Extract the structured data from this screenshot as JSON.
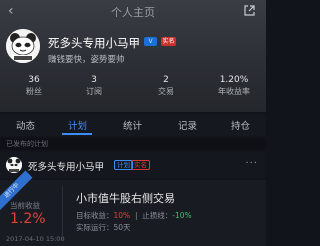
{
  "header": {
    "title": "个人主页",
    "back_glyph": "‹",
    "share_icon": "share-icon"
  },
  "profile": {
    "username": "死多头专用小马甲",
    "badge_v": "V",
    "badge_sm": "实名",
    "bio": "赚钱要快，姿势要帅"
  },
  "stats": [
    {
      "value": "36",
      "label": "粉丝"
    },
    {
      "value": "3",
      "label": "订阅"
    },
    {
      "value": "2",
      "label": "交易"
    },
    {
      "value": "1.20%",
      "label": "年收益率"
    }
  ],
  "tabs": [
    {
      "label": "动态",
      "active": false
    },
    {
      "label": "计划",
      "active": true
    },
    {
      "label": "统计",
      "active": false
    },
    {
      "label": "记录",
      "active": false
    },
    {
      "label": "持仓",
      "active": false
    }
  ],
  "section_head": "已发布的计划",
  "row": {
    "name": "死多头专用小马甲",
    "tag_plan": "计划",
    "tag_real": "实名",
    "dots": "···"
  },
  "card": {
    "ribbon": "进行中",
    "current_label": "当前收益",
    "current_value": "1.2%",
    "start_time": "2017-04-10 15:00",
    "title": "小市值牛股右侧交易",
    "target_label": "目标收益：",
    "target_value": "10%",
    "stop_label": "止损线：",
    "stop_value": "-10%",
    "run_label": "实际运行：",
    "run_value": "50天",
    "colors": {
      "positive": "#3ec16a",
      "negative": "#e0423b",
      "accent": "#3d8cff"
    }
  }
}
